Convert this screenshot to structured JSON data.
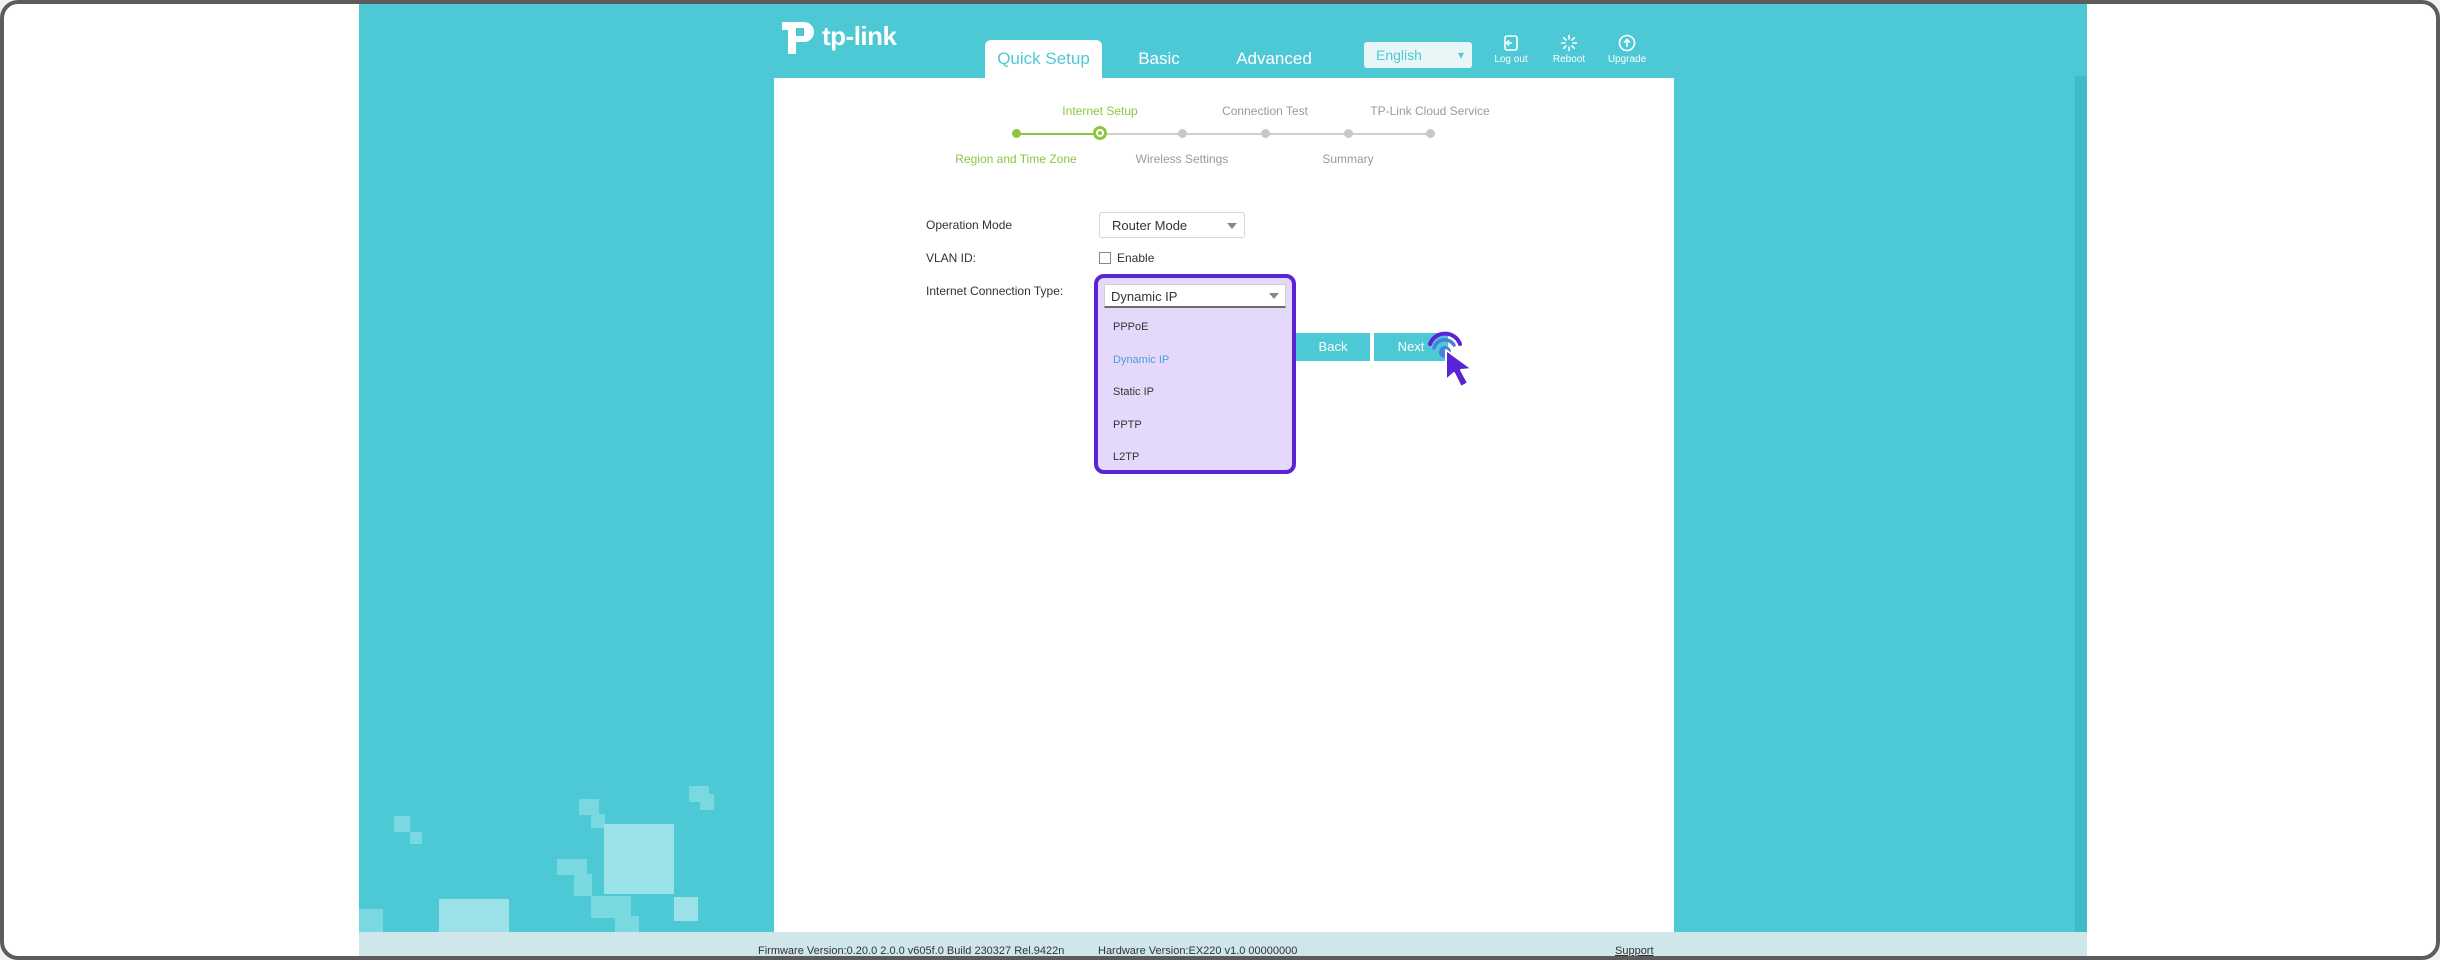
{
  "brand": {
    "logo_text": "tp-link"
  },
  "nav": {
    "tabs": [
      {
        "label": "Quick Setup",
        "active": true
      },
      {
        "label": "Basic",
        "active": false
      },
      {
        "label": "Advanced",
        "active": false
      }
    ]
  },
  "language": {
    "selected": "English"
  },
  "toolbar": {
    "logout": "Log out",
    "reboot": "Reboot",
    "upgrade": "Upgrade"
  },
  "steps": {
    "top": [
      "Internet Setup",
      "Connection Test",
      "TP-Link Cloud Service"
    ],
    "bottom": [
      "Region and Time Zone",
      "Wireless Settings",
      "Summary"
    ]
  },
  "form": {
    "operation_mode_label": "Operation Mode",
    "operation_mode_value": "Router Mode",
    "vlan_label": "VLAN ID:",
    "vlan_enable_label": "Enable",
    "connection_type_label": "Internet Connection Type:",
    "connection_type_value": "Dynamic IP",
    "options": [
      "PPPoE",
      "Dynamic IP",
      "Static IP",
      "PPTP",
      "L2TP"
    ]
  },
  "buttons": {
    "back": "Back",
    "next": "Next"
  },
  "footer": {
    "firmware": "Firmware Version:0.20.0 2.0.0 v605f.0 Build 230327 Rel.9422n",
    "hardware": "Hardware Version:EX220 v1.0 00000000",
    "support": "Support"
  },
  "colors": {
    "accent": "#4dc9d5",
    "progress": "#8cc63f",
    "highlight": "#5a23d6"
  }
}
